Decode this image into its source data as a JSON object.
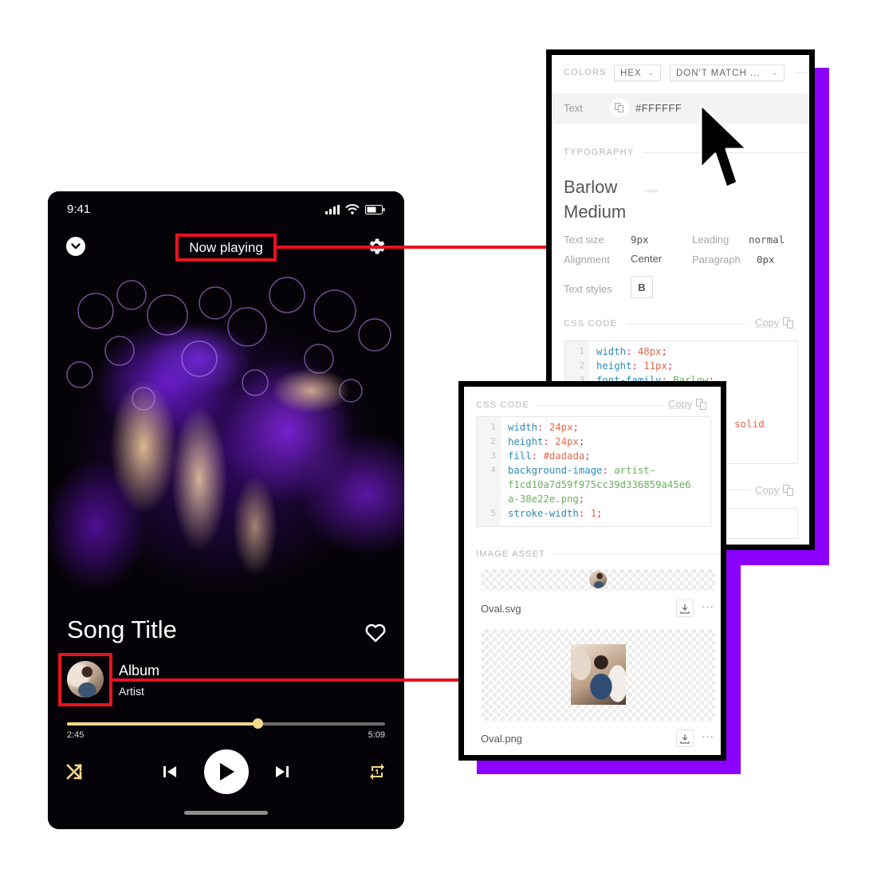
{
  "phone": {
    "status_bar": {
      "time": "9:41",
      "icons": [
        "signal-icon",
        "wifi-icon",
        "battery-icon"
      ]
    },
    "header": {
      "collapse_icon": "chevron-down-icon",
      "title": "Now playing",
      "settings_icon": "gear-icon"
    },
    "track": {
      "song_title": "Song Title",
      "album": "Album",
      "artist": "Artist",
      "favorite_icon": "heart-outline-icon"
    },
    "playback": {
      "elapsed": "2:45",
      "total": "5:09",
      "progress_fraction": 0.6,
      "controls": [
        "shuffle-icon",
        "previous-icon",
        "play-icon",
        "next-icon",
        "repeat-one-icon"
      ]
    },
    "colors": {
      "accent": "#f5d98a",
      "highlight_box": "#e8121f"
    }
  },
  "inspector_text": {
    "colors_label": "COLORS",
    "format_dropdown": "HEX",
    "match_dropdown": "DON'T MATCH ...",
    "color_row": {
      "label": "Text",
      "value": "#FFFFFF"
    },
    "typography_label": "TYPOGRAPHY",
    "font_name_line1": "Barlow",
    "font_name_line2": "Medium",
    "font_source": "Google",
    "properties": {
      "text_size_label": "Text size",
      "text_size": "9px",
      "leading_label": "Leading",
      "leading": "normal",
      "alignment_label": "Alignment",
      "alignment": "Center",
      "paragraph_label": "Paragraph",
      "paragraph": "0px",
      "text_styles_label": "Text styles",
      "text_style": "B"
    },
    "css_label": "CSS CODE",
    "copy_label": "Copy",
    "css_lines": [
      {
        "num": "1",
        "prop": "width",
        "val": "48px",
        "type": "n"
      },
      {
        "num": "2",
        "prop": "height",
        "val": "11px",
        "type": "n"
      },
      {
        "num": "3",
        "prop": "font-family",
        "val": "Barlow",
        "type": "s"
      }
    ],
    "css_partial_visible": "solid",
    "second_copy_label": "Copy"
  },
  "inspector_image": {
    "css_label": "CSS CODE",
    "copy_label": "Copy",
    "css_lines": [
      {
        "num": "1",
        "prop": "width",
        "val": "24px",
        "type": "n"
      },
      {
        "num": "2",
        "prop": "height",
        "val": "24px",
        "type": "n"
      },
      {
        "num": "3",
        "prop": "fill",
        "val": "#dadada",
        "type": "n"
      },
      {
        "num": "4",
        "prop": "background-image",
        "val": "artist-",
        "type": "s"
      },
      {
        "num": "",
        "prop": "",
        "val": "f1cd10a7d59f975cc39d336859a45e6",
        "type": "s"
      },
      {
        "num": "",
        "prop": "",
        "val": "a-38e22e.png",
        "type": "s"
      },
      {
        "num": "5",
        "prop": "stroke-width",
        "val": "1",
        "type": "n"
      }
    ],
    "asset_label": "IMAGE ASSET",
    "assets": [
      {
        "name": "Oval.svg",
        "download_icon": "download-icon",
        "more": "···"
      },
      {
        "name": "Oval.png",
        "download_icon": "download-icon",
        "more": "···"
      }
    ]
  },
  "decor": {
    "backdrop_color": "#8b00ff",
    "frame_color": "#000000"
  }
}
